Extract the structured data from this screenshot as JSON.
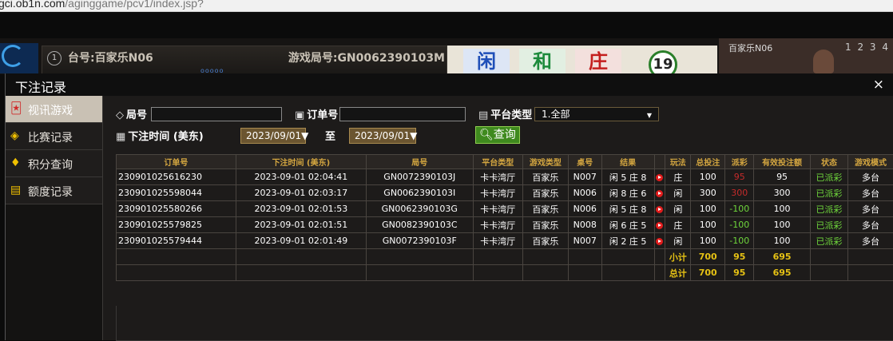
{
  "browser": {
    "url_host": "gci.ob1n.com",
    "url_path": "/aginggame/pcv1/index.jsp?"
  },
  "background": {
    "table_number": "1",
    "table_name": "台号:百家乐N06",
    "game_round": "游戏局号:GN0062390103M",
    "dots": "ooooo",
    "board": {
      "player": "闲",
      "tie": "和",
      "banker": "庄"
    },
    "count": "19",
    "preview": {
      "table": "百家乐N06",
      "nums": "1 2 3 4"
    }
  },
  "modal": {
    "title": "下注记录",
    "close": "×"
  },
  "sidebar": {
    "items": [
      {
        "label": "视讯游戏",
        "icon": "cards-icon",
        "glyph": "🃏"
      },
      {
        "label": "比赛记录",
        "icon": "tag-icon",
        "glyph": "◈"
      },
      {
        "label": "积分查询",
        "icon": "diamond-icon",
        "glyph": "♦"
      },
      {
        "label": "额度记录",
        "icon": "document-icon",
        "glyph": "▤"
      }
    ]
  },
  "filters": {
    "round_label": "局号",
    "order_label": "订单号",
    "platform_label": "平台类型",
    "platform_value": "1.全部",
    "time_label": "下注时间 (美东)",
    "date_from": "2023/09/01",
    "to_label": "至",
    "date_to": "2023/09/01",
    "query_label": "查询"
  },
  "table": {
    "headers": [
      "订单号",
      "下注时间 (美东)",
      "局号",
      "平台类型",
      "游戏类型",
      "桌号",
      "结果",
      "",
      "玩法",
      "总投注",
      "派彩",
      "有效投注额",
      "状态",
      "游戏模式"
    ],
    "rows": [
      [
        "230901025616230",
        "2023-09-01 02:04:41",
        "GN0072390103J",
        "卡卡湾厅",
        "百家乐",
        "N007",
        "闲 5 庄 8",
        "",
        "庄",
        "100",
        "95",
        "95",
        "已派彩",
        "多台"
      ],
      [
        "230901025598044",
        "2023-09-01 02:03:17",
        "GN0062390103I",
        "卡卡湾厅",
        "百家乐",
        "N006",
        "闲 8 庄 6",
        "",
        "闲",
        "300",
        "300",
        "300",
        "已派彩",
        "多台"
      ],
      [
        "230901025580266",
        "2023-09-01 02:01:53",
        "GN0062390103G",
        "卡卡湾厅",
        "百家乐",
        "N006",
        "闲 5 庄 8",
        "",
        "闲",
        "100",
        "-100",
        "100",
        "已派彩",
        "多台"
      ],
      [
        "230901025579825",
        "2023-09-01 02:01:51",
        "GN0082390103C",
        "卡卡湾厅",
        "百家乐",
        "N008",
        "闲 6 庄 5",
        "",
        "庄",
        "100",
        "-100",
        "100",
        "已派彩",
        "多台"
      ],
      [
        "230901025579444",
        "2023-09-01 02:01:49",
        "GN0072390103F",
        "卡卡湾厅",
        "百家乐",
        "N007",
        "闲 2 庄 5",
        "",
        "闲",
        "100",
        "-100",
        "100",
        "已派彩",
        "多台"
      ]
    ],
    "payout_colors": [
      "red",
      "red",
      "green",
      "green",
      "green"
    ],
    "subtotal": {
      "label": "小计",
      "bet": "700",
      "payout": "95",
      "valid": "695"
    },
    "total": {
      "label": "总计",
      "bet": "700",
      "payout": "95",
      "valid": "695"
    }
  }
}
